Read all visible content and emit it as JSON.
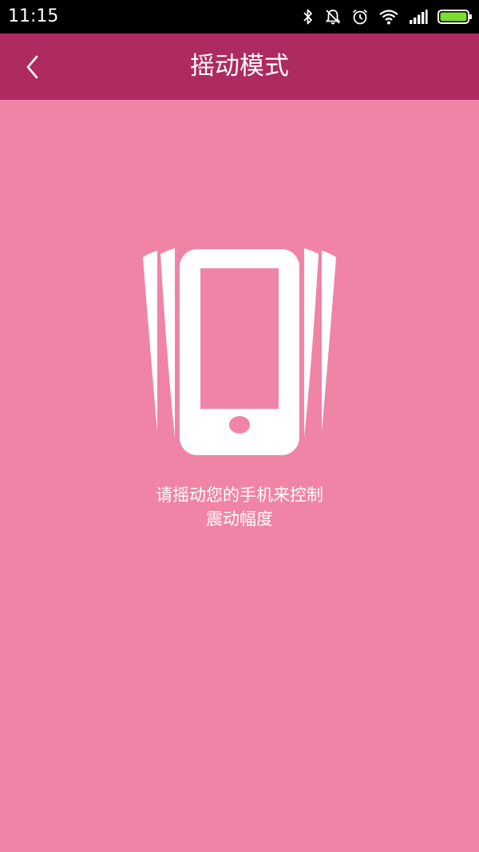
{
  "status_bar": {
    "time": "11:15",
    "icons": [
      "bluetooth-icon",
      "notifications-off-icon",
      "alarm-icon",
      "wifi-icon",
      "signal-icon",
      "battery-icon"
    ],
    "battery_color": "#7ddc2f"
  },
  "header": {
    "title": "摇动模式",
    "back_icon": "chevron-left-icon",
    "background": "#ad2b60"
  },
  "main": {
    "background": "#f084a7",
    "illustration_icon": "shaking-phone-icon",
    "instruction_line1": "请摇动您的手机来控制",
    "instruction_line2": "震动幅度"
  }
}
